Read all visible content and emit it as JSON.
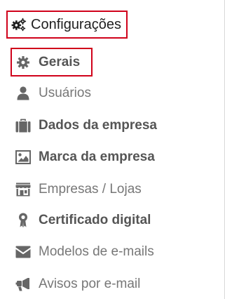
{
  "header": {
    "label": "Configurações",
    "icon": "cogs-icon"
  },
  "menu": {
    "items": [
      {
        "label": "Gerais",
        "icon": "gear-icon",
        "selected": true,
        "bold": true
      },
      {
        "label": "Usuários",
        "icon": "user-icon",
        "selected": false,
        "bold": false
      },
      {
        "label": "Dados da empresa",
        "icon": "briefcase-icon",
        "selected": false,
        "bold": true
      },
      {
        "label": "Marca da empresa",
        "icon": "image-icon",
        "selected": false,
        "bold": true
      },
      {
        "label": "Empresas / Lojas",
        "icon": "store-icon",
        "selected": false,
        "bold": false
      },
      {
        "label": "Certificado digital",
        "icon": "certificate-icon",
        "selected": false,
        "bold": true
      },
      {
        "label": "Modelos de e-mails",
        "icon": "envelope-icon",
        "selected": false,
        "bold": false
      },
      {
        "label": "Avisos por e-mail",
        "icon": "megaphone-icon",
        "selected": false,
        "bold": false
      }
    ]
  },
  "colors": {
    "highlight_border": "#d0021b",
    "icon": "#666666",
    "text_bold": "#555555",
    "text_regular": "#777777"
  }
}
